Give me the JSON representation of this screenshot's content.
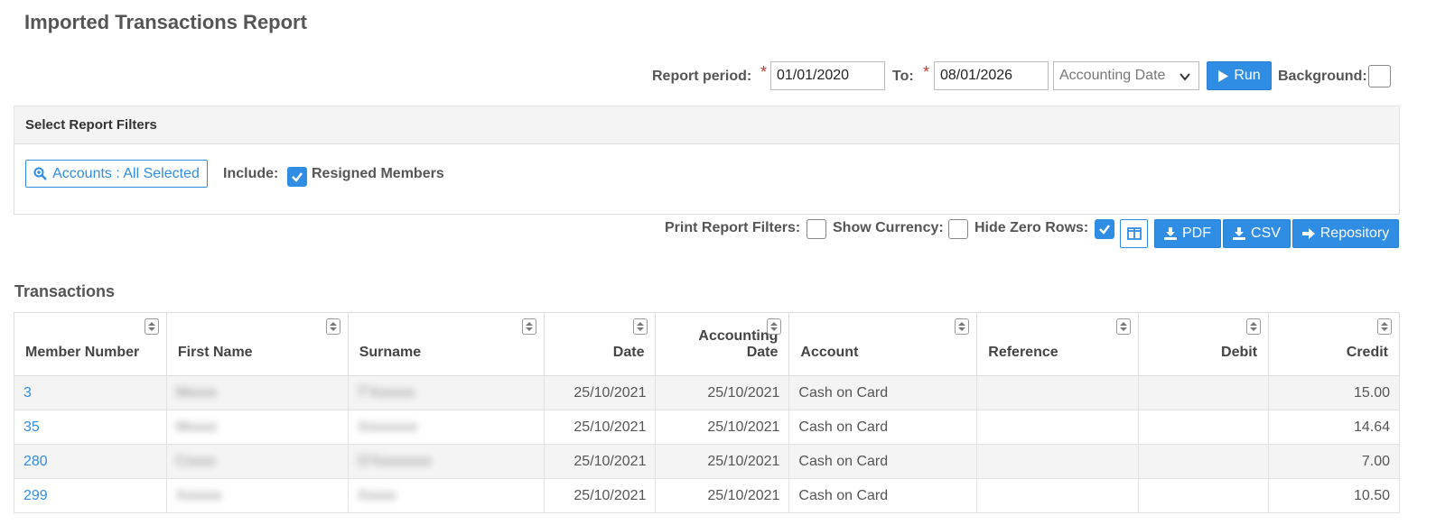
{
  "page": {
    "title": "Imported Transactions Report"
  },
  "period": {
    "label": "Report period:",
    "required_mark": "*",
    "from": "01/01/2020",
    "to_label": "To:",
    "to": "08/01/2026",
    "date_type": "Accounting Date",
    "run_label": "Run",
    "background_label": "Background:"
  },
  "filters": {
    "header": "Select Report Filters",
    "accounts_button": "Accounts : All Selected",
    "include_label": "Include:",
    "resigned_members_label": "Resigned Members",
    "resigned_members_checked": true
  },
  "options": {
    "print_filters_label": "Print Report Filters:",
    "show_currency_label": "Show Currency:",
    "hide_zero_rows_label": "Hide Zero Rows:",
    "hide_zero_rows_checked": true,
    "pdf_label": "PDF",
    "csv_label": "CSV",
    "repository_label": "Repository"
  },
  "transactions": {
    "title": "Transactions",
    "columns": [
      "Member Number",
      "First Name",
      "Surname",
      "Date",
      "Accounting Date",
      "Account",
      "Reference",
      "Debit",
      "Credit"
    ],
    "rows": [
      {
        "member": "3",
        "first": "Mxxxx",
        "surname": "T'Xxxxxx",
        "date": "25/10/2021",
        "acc_date": "25/10/2021",
        "account": "Cash on Card",
        "reference": "",
        "debit": "",
        "credit": "15.00"
      },
      {
        "member": "35",
        "first": "Mxxxx",
        "surname": "Xxxxxxxx",
        "date": "25/10/2021",
        "acc_date": "25/10/2021",
        "account": "Cash on Card",
        "reference": "",
        "debit": "",
        "credit": "14.64"
      },
      {
        "member": "280",
        "first": "Cxxxx",
        "surname": "O'Xxxxxxxx",
        "date": "25/10/2021",
        "acc_date": "25/10/2021",
        "account": "Cash on Card",
        "reference": "",
        "debit": "",
        "credit": "7.00"
      },
      {
        "member": "299",
        "first": "Xxxxxx",
        "surname": "Xxxxx",
        "date": "25/10/2021",
        "acc_date": "25/10/2021",
        "account": "Cash on Card",
        "reference": "",
        "debit": "",
        "credit": "10.50"
      }
    ]
  },
  "colors": {
    "accent": "#2f8de4",
    "required": "#c0392b",
    "header_bg": "#f4f4f4"
  }
}
